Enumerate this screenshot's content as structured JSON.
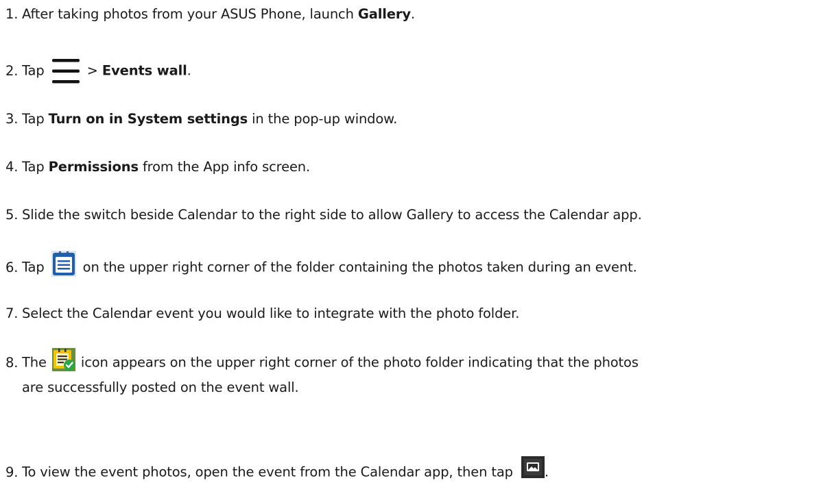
{
  "steps": [
    {
      "num": "1.",
      "pre": "After taking photos from your ASUS Phone, launch ",
      "bold": "Gallery",
      "post": "."
    },
    {
      "num": "2.",
      "pre": "Tap ",
      "mid": " > ",
      "bold": "Events wall",
      "post": ".",
      "icon": "hamburger-menu-icon"
    },
    {
      "num": "3.",
      "pre": "Tap ",
      "bold": "Turn on in System settings",
      "post": " in the pop-up window."
    },
    {
      "num": "4.",
      "pre": "Tap ",
      "bold": "Permissions",
      "post": " from the App info screen."
    },
    {
      "num": "5.",
      "text": "Slide the switch beside Calendar to the right side to allow Gallery to access the Calendar app."
    },
    {
      "num": "6.",
      "pre": "Tap ",
      "post": " on the upper right corner of the folder containing the photos taken during an event.",
      "icon": "calendar-list-icon"
    },
    {
      "num": "7.",
      "text": "Select the Calendar event you would like to integrate with the photo folder."
    },
    {
      "num": "8.",
      "pre": "The ",
      "post": " icon appears on the upper right corner of the photo folder indicating that the photos",
      "cont": "are successfully posted on the event wall.",
      "icon": "event-posted-icon"
    },
    {
      "num": "9.",
      "pre": "To view the event photos, open the event from the Calendar app, then tap ",
      "post": ".",
      "icon": "photo-gallery-icon"
    }
  ],
  "colors": {
    "text": "#1a1a1a",
    "calendar_icon_blue": "#1f5fae",
    "event_icon_yellow": "#f2c300",
    "event_icon_check": "#2aa64a",
    "photo_icon_dark": "#2b2b2b"
  }
}
